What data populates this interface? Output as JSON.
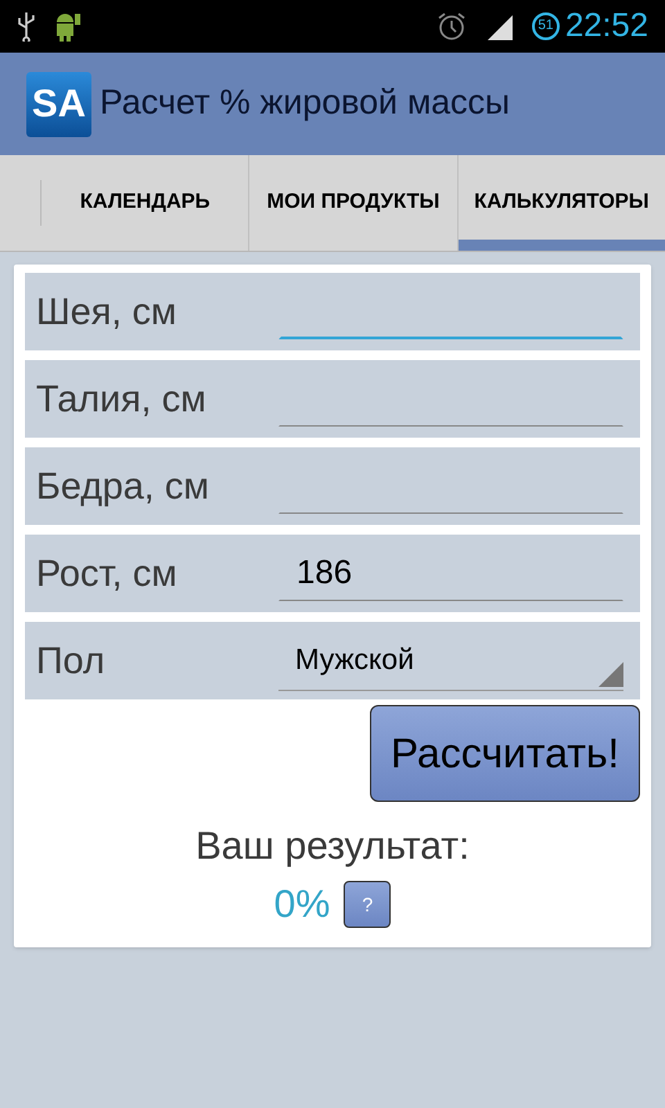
{
  "status_bar": {
    "battery": "51",
    "time": "22:52"
  },
  "app_bar": {
    "logo": "SA",
    "title": "Расчет % жировой массы"
  },
  "tabs": [
    {
      "label": "КАЛЕНДАРЬ",
      "selected": false
    },
    {
      "label": "МОИ ПРОДУКТЫ",
      "selected": false
    },
    {
      "label": "КАЛЬКУЛЯТОРЫ",
      "selected": true
    }
  ],
  "form": [
    {
      "kind": "text",
      "label": "Шея, см",
      "focused": true
    },
    {
      "kind": "text",
      "label": "Талия, см",
      "focused": false
    },
    {
      "kind": "text",
      "label": "Бедра, см",
      "focused": false
    },
    {
      "kind": "text",
      "label": "Рост, см",
      "value": "186",
      "focused": false
    },
    {
      "kind": "select",
      "label": "Пол",
      "value": "Мужской"
    }
  ],
  "calculate_button": "Рассчитать!",
  "result": {
    "label": "Ваш результат:",
    "value": "0%",
    "help": "?"
  }
}
